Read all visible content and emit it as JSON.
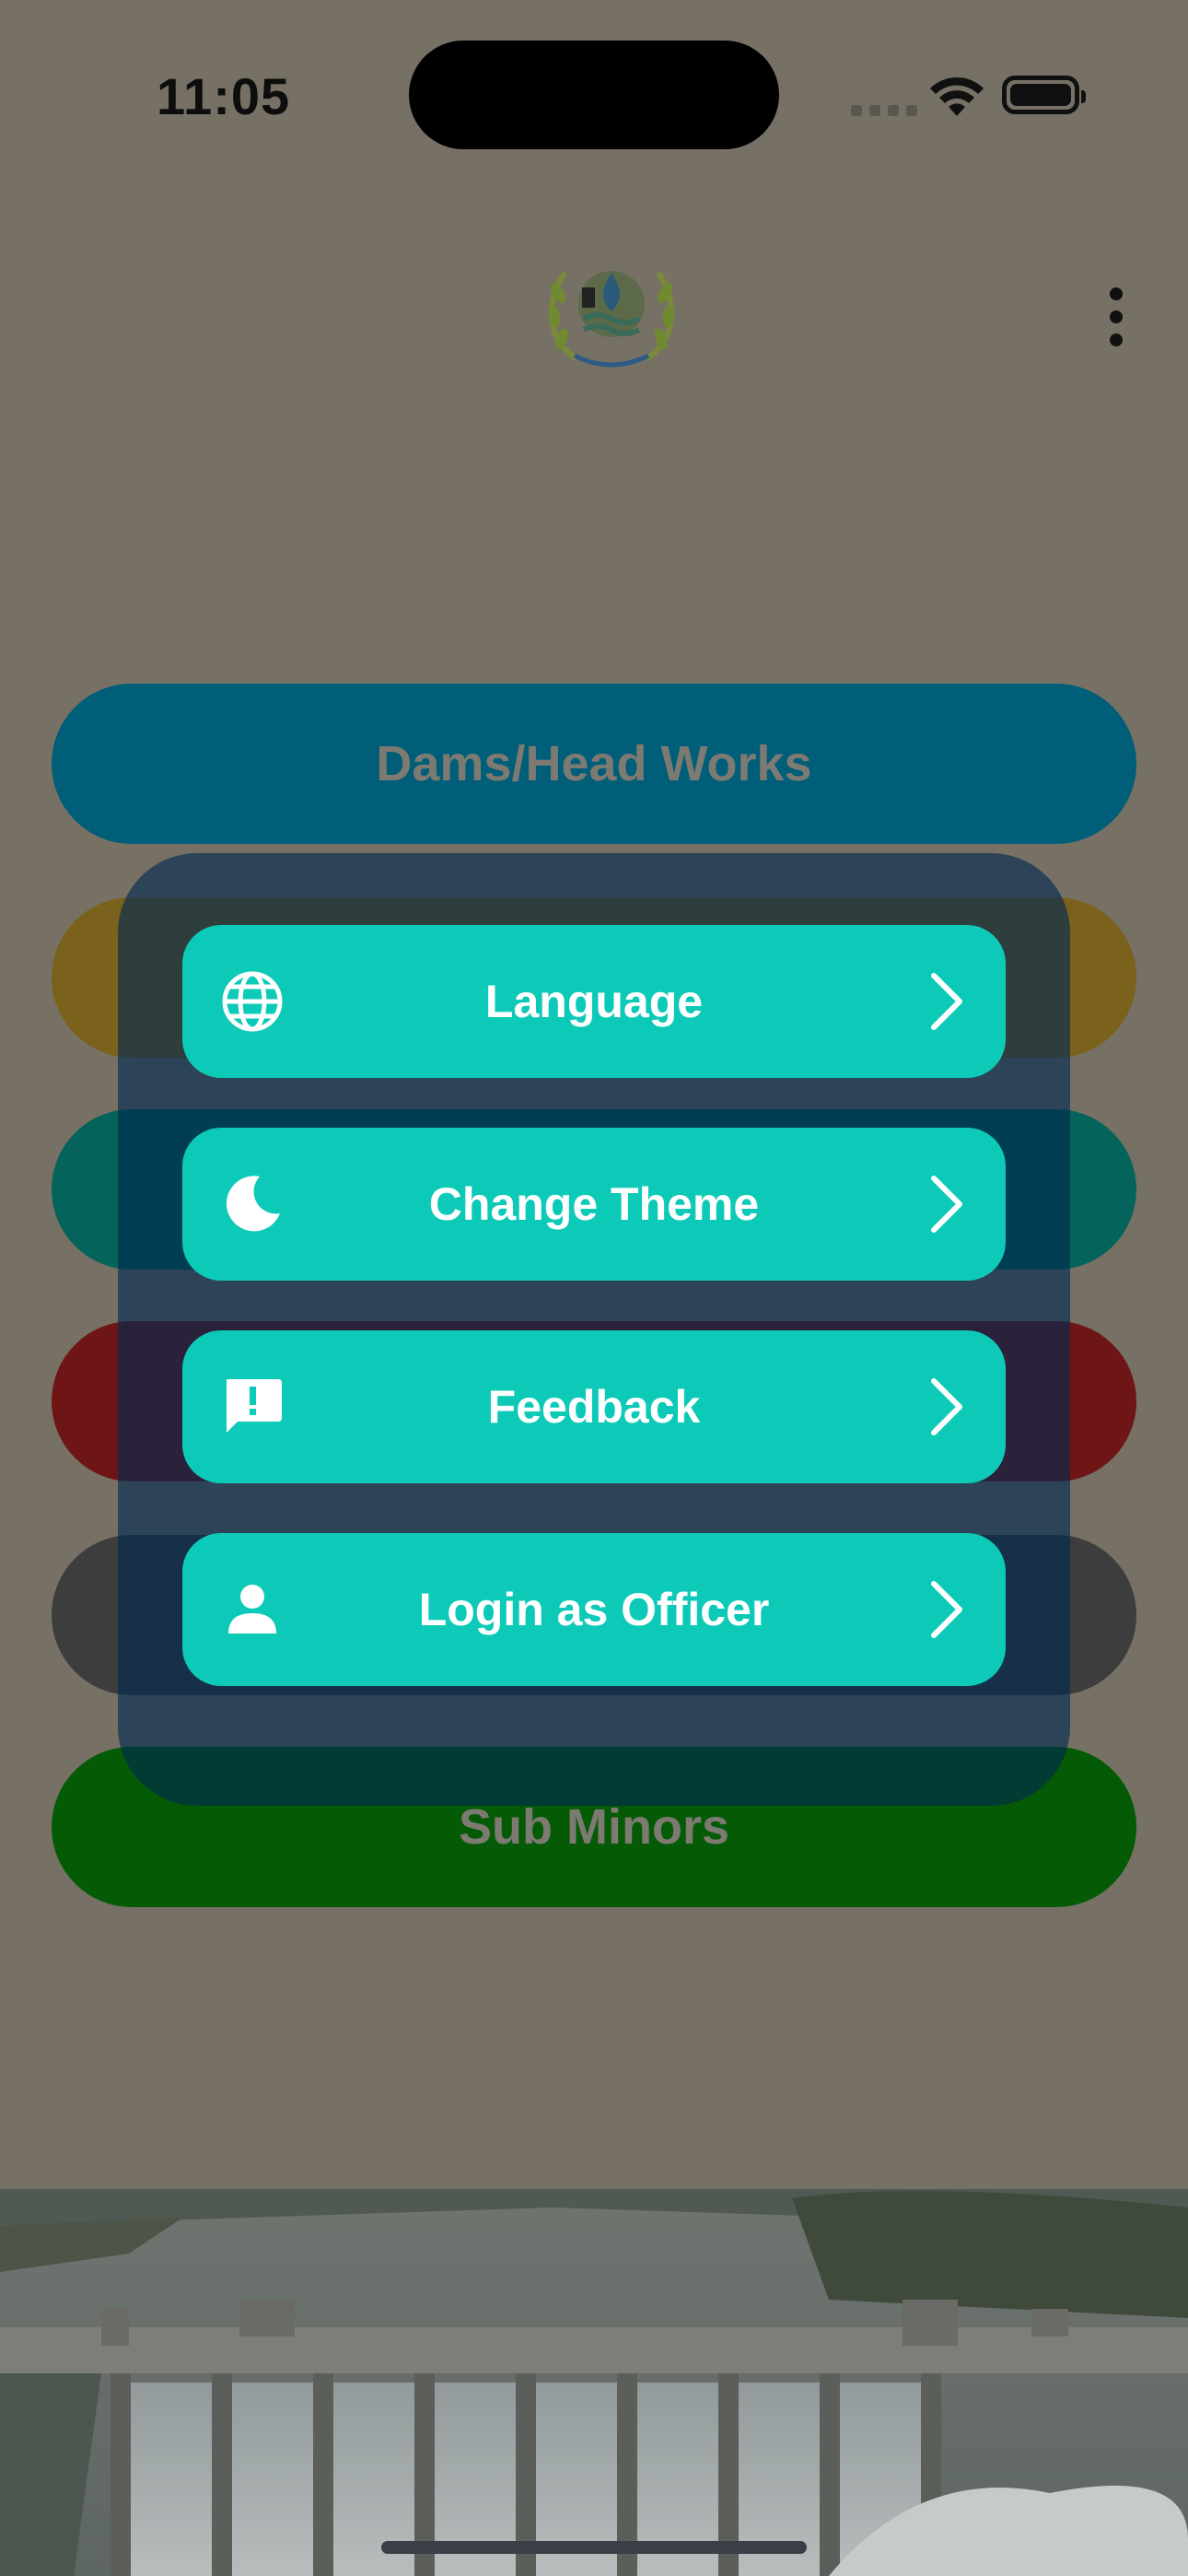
{
  "status_bar": {
    "time": "11:05"
  },
  "header": {
    "logo_icon": "department-emblem",
    "menu_icon": "more-vertical-icon"
  },
  "main_buttons": [
    {
      "label": "Dams/Head Works",
      "color": "#005e79"
    },
    {
      "label": "",
      "color": "#7a611c"
    },
    {
      "label": "",
      "color": "#04635a"
    },
    {
      "label": "",
      "color": "#6e1515"
    },
    {
      "label": "",
      "color": "#3d3d3d"
    },
    {
      "label": "Sub Minors",
      "color": "#055a06"
    }
  ],
  "popup_menu": {
    "items": [
      {
        "label": "Language",
        "icon": "globe-icon"
      },
      {
        "label": "Change Theme",
        "icon": "moon-icon"
      },
      {
        "label": "Feedback",
        "icon": "feedback-icon"
      },
      {
        "label": "Login as Officer",
        "icon": "person-icon"
      }
    ],
    "accent": "#0dcab8"
  }
}
